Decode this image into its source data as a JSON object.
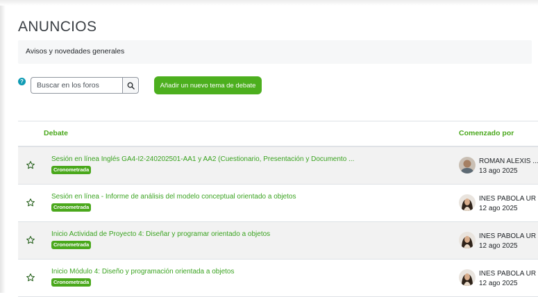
{
  "page": {
    "title": "ANUNCIOS",
    "description": "Avisos y novedades generales"
  },
  "toolbar": {
    "help_icon": "question-circle-icon",
    "search_placeholder": "Buscar en los foros",
    "search_icon": "search-icon",
    "add_topic_label": "Añadir un nuevo tema de debate"
  },
  "colors": {
    "accent_green": "#4caf1e",
    "link_green": "#3aa320",
    "help_blue": "#0f9bb4"
  },
  "table": {
    "columns": {
      "debate": "Debate",
      "started_by": "Comenzado por"
    },
    "rows": [
      {
        "title": "Sesión en línea Inglés GA4-I2-240202501-AA1 y AA2 (Cuestionario, Presentación y Documento ...",
        "badge": "Cronometrada",
        "author": "ROMAN ALEXIS ...",
        "date": "13 ago 2025"
      },
      {
        "title": "Sesión en línea - Informe de análisis del modelo conceptual orientado a objetos",
        "badge": "Cronometrada",
        "author": "INES PABOLA UR",
        "date": "12 ago 2025"
      },
      {
        "title": "Inicio Actividad de Proyecto 4: Diseñar y programar orientado a objetos",
        "badge": "Cronometrada",
        "author": "INES PABOLA UR",
        "date": "12 ago 2025"
      },
      {
        "title": "Inicio Módulo 4: Diseño y programación orientada a objetos",
        "badge": "Cronometrada",
        "author": "INES PABOLA UR",
        "date": "12 ago 2025"
      }
    ]
  }
}
